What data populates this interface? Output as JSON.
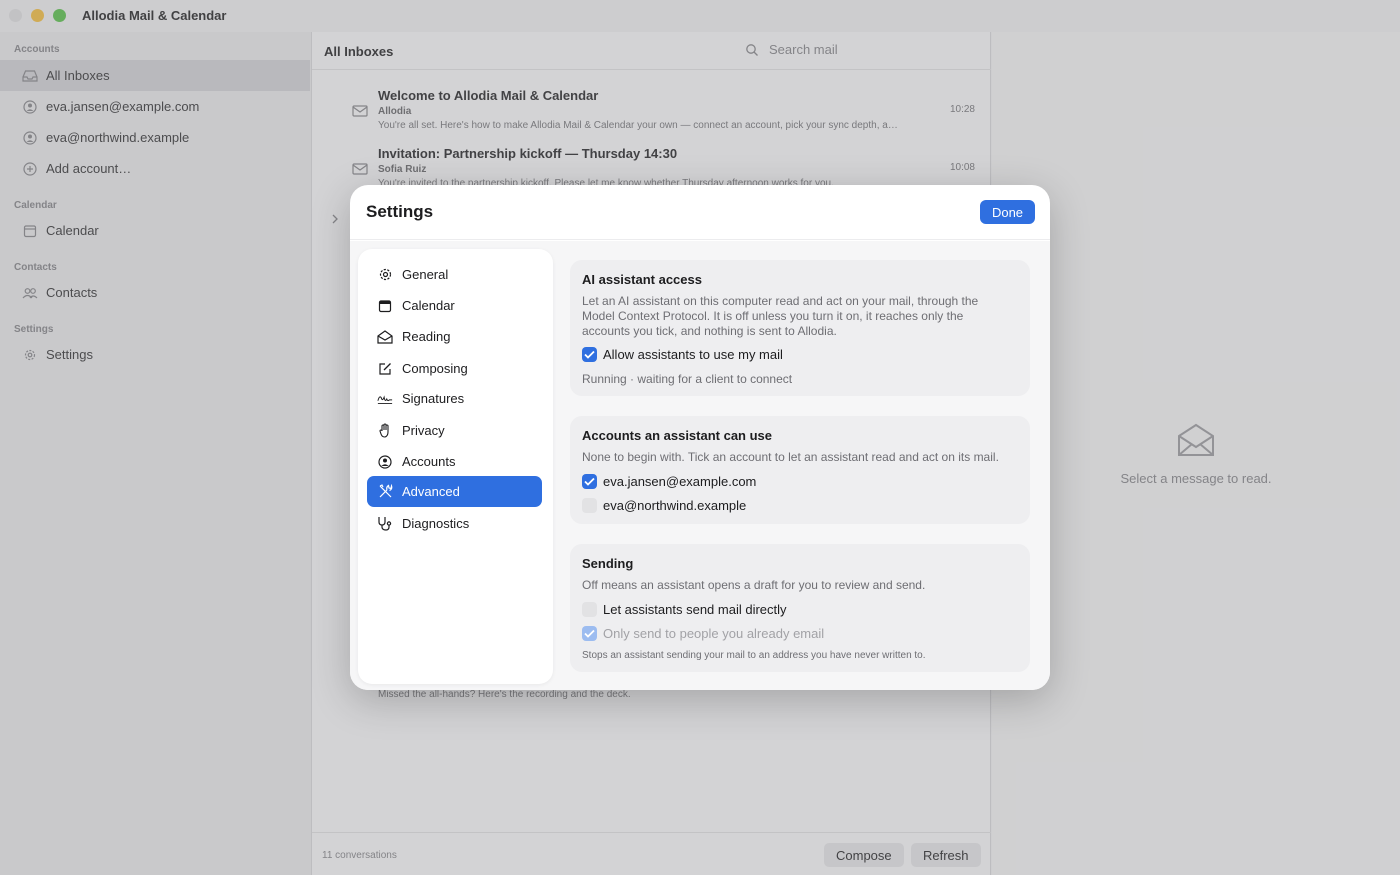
{
  "app": {
    "title": "Allodia Mail & Calendar"
  },
  "sidebar": {
    "sections": {
      "accounts": "Accounts",
      "calendar": "Calendar",
      "contacts": "Contacts",
      "settings": "Settings"
    },
    "items": [
      {
        "label": "All Inboxes",
        "icon": "inbox-icon"
      },
      {
        "label": "eva.jansen@example.com",
        "icon": "person-icon"
      },
      {
        "label": "eva@northwind.example",
        "icon": "person-icon"
      },
      {
        "label": "Add account…",
        "icon": "plus-circle-icon"
      },
      {
        "label": "Calendar",
        "icon": "calendar-icon"
      },
      {
        "label": "Contacts",
        "icon": "people-icon"
      },
      {
        "label": "Settings",
        "icon": "gear-icon"
      }
    ]
  },
  "list": {
    "title": "All Inboxes",
    "search_placeholder": "Search mail",
    "messages": [
      {
        "subject": "Welcome to Allodia Mail & Calendar",
        "from": "Allodia",
        "preview": "You're all set. Here's how to make Allodia Mail & Calendar your own — connect an account, pick your sync depth, a…",
        "time": "10:28"
      },
      {
        "subject": "Invitation: Partnership kickoff — Thursday 14:30",
        "from": "Sofia Ruiz",
        "preview": "You're invited to the partnership kickoff. Please let me know whether Thursday afternoon works for you.",
        "time": "10:08"
      }
    ],
    "bottom_preview": "Missed the all-hands? Here's the recording and the deck.",
    "footer": {
      "count": "11 conversations",
      "compose": "Compose",
      "refresh": "Refresh"
    }
  },
  "reader": {
    "hint": "Select a message to read."
  },
  "settings": {
    "title": "Settings",
    "done": "Done",
    "nav": [
      {
        "label": "General",
        "icon": "gear-icon"
      },
      {
        "label": "Calendar",
        "icon": "calendar-icon"
      },
      {
        "label": "Reading",
        "icon": "envelope-open-icon"
      },
      {
        "label": "Composing",
        "icon": "compose-icon"
      },
      {
        "label": "Signatures",
        "icon": "signature-icon"
      },
      {
        "label": "Privacy",
        "icon": "hand-icon"
      },
      {
        "label": "Accounts",
        "icon": "person-circle-icon"
      },
      {
        "label": "Advanced",
        "icon": "tools-icon",
        "selected": true
      },
      {
        "label": "Diagnostics",
        "icon": "stethoscope-icon"
      }
    ],
    "ai_access": {
      "title": "AI assistant access",
      "description": "Let an AI assistant on this computer read and act on your mail, through the Model Context Protocol. It is off unless you turn it on, it reaches only the accounts you tick, and nothing is sent to Allodia.",
      "allow_label": "Allow assistants to use my mail",
      "allow_checked": true,
      "status": "Running · waiting for a client to connect"
    },
    "accounts_card": {
      "title": "Accounts an assistant can use",
      "description": "None to begin with. Tick an account to let an assistant read and act on its mail.",
      "accounts": [
        {
          "label": "eva.jansen@example.com",
          "checked": true
        },
        {
          "label": "eva@northwind.example",
          "checked": false
        }
      ]
    },
    "sending": {
      "title": "Sending",
      "description": "Off means an assistant opens a draft for you to review and send.",
      "send_direct_label": "Let assistants send mail directly",
      "send_direct_checked": false,
      "known_only_label": "Only send to people you already email",
      "known_only_checked": true,
      "known_only_enabled": false,
      "note": "Stops an assistant sending your mail to an address you have never written to."
    }
  },
  "colors": {
    "accent": "#2f6fe0",
    "traffic_close": "#e2e2e4",
    "traffic_min": "#f6c245",
    "traffic_max": "#5fc551"
  }
}
